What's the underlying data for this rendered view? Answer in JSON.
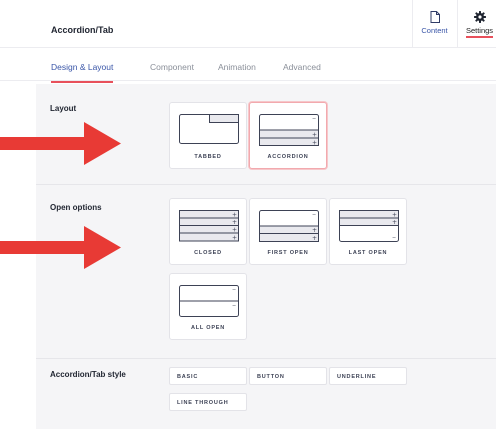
{
  "header": {
    "title": "Accordion/Tab",
    "content_label": "Content",
    "settings_label": "Settings"
  },
  "tabs": [
    {
      "label": "Design & Layout",
      "active": true
    },
    {
      "label": "Component",
      "active": false
    },
    {
      "label": "Animation",
      "active": false
    },
    {
      "label": "Advanced",
      "active": false
    }
  ],
  "layout": {
    "label": "Layout",
    "options": [
      {
        "label": "TABBED",
        "icon": "tabbed-layout-icon",
        "selected": false
      },
      {
        "label": "ACCORDION",
        "icon": "accordion-layout-icon",
        "selected": true
      }
    ]
  },
  "open_options": {
    "label": "Open options",
    "options": [
      {
        "label": "CLOSED",
        "icon": "closed-accordion-icon"
      },
      {
        "label": "FIRST OPEN",
        "icon": "first-open-accordion-icon"
      },
      {
        "label": "LAST OPEN",
        "icon": "last-open-accordion-icon"
      },
      {
        "label": "ALL OPEN",
        "icon": "all-open-accordion-icon"
      }
    ]
  },
  "style": {
    "label": "Accordion/Tab style",
    "options": [
      "BASIC",
      "BUTTON",
      "UNDERLINE",
      "LINE THROUGH"
    ]
  },
  "colors": {
    "accent": "#e8505b",
    "link": "#3a56a8",
    "arrow": "#e83a35",
    "panel_bg": "#f5f5f7"
  }
}
